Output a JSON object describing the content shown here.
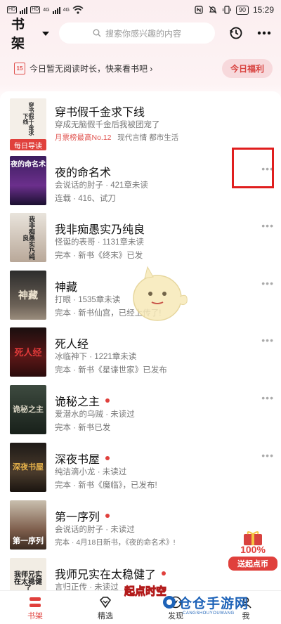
{
  "status_bar": {
    "network_labels": [
      "HD",
      "HD",
      "4G",
      "4G"
    ],
    "battery": "90",
    "time": "15:29"
  },
  "header": {
    "title": "书架",
    "search_placeholder": "搜索你感兴趣的内容"
  },
  "promo": {
    "calendar_day": "15",
    "text": "今日暂无阅读时长，快来看书吧 ›",
    "button": "今日福利"
  },
  "books": [
    {
      "title": "穿书假千金求下线",
      "line1": "穿成无脑假千金后我被团宠了",
      "rank": "月票榜最高No.12",
      "tags": "现代言情   都市生活",
      "badge": "每日导读",
      "cover_text": "穿书假千金求下线"
    },
    {
      "title": "夜的命名术",
      "line1": "会说话的肘子 · 421章未读",
      "line2": "连载 · 416、试刀",
      "cover_text": "夜的命名术"
    },
    {
      "title": "我非痴愚实乃纯良",
      "line1": "怪诞的表哥 · 1131章未读",
      "line2": "完本 · 新书《终末》已发",
      "cover_text": "我非痴愚实乃纯良"
    },
    {
      "title": "神藏",
      "line1": "打眼 · 1535章未读",
      "line2": "完本 · 新书仙宫，已经上传了!",
      "cover_text": "神藏"
    },
    {
      "title": "死人经",
      "line1": "冰临神下 · 1221章未读",
      "line2": "完本 · 新书《星谍世家》已发布",
      "cover_text": "死人经"
    },
    {
      "title": "诡秘之主",
      "line1": "爱潜水的乌贼 · 未读过",
      "line2": "完本 · 新书已发",
      "cover_text": "诡秘之主"
    },
    {
      "title": "深夜书屋",
      "line1": "纯洁滴小龙 · 未读过",
      "line2": "完本 · 新书《魔临》，已发布!",
      "cover_text": "深夜书屋"
    },
    {
      "title": "第一序列",
      "line1": "会说话的肘子 · 未读过",
      "line2": "完本 · 4月18日新书，《夜的命名术》!",
      "cover_text": "第一序列"
    },
    {
      "title": "我师兄实在太稳健了",
      "line1": "言归正传 · 未读过",
      "cover_text": "我师兄实在太稳健了"
    }
  ],
  "float_badge": {
    "percent": "100%",
    "text": "送起点币"
  },
  "bottom_nav": [
    {
      "label": "书架",
      "active": true
    },
    {
      "label": "精选",
      "active": false
    },
    {
      "label": "发现",
      "active": false
    },
    {
      "label": "我",
      "active": false
    }
  ],
  "overlay": {
    "qidian_text": "起点时空",
    "watermark": "仓仓手游网",
    "watermark_sub": "CANGSHOUYOUWANG"
  },
  "colors": {
    "accent": "#e0403c",
    "highlight_box": "#e01e1e",
    "watermark": "#1e63b8"
  }
}
